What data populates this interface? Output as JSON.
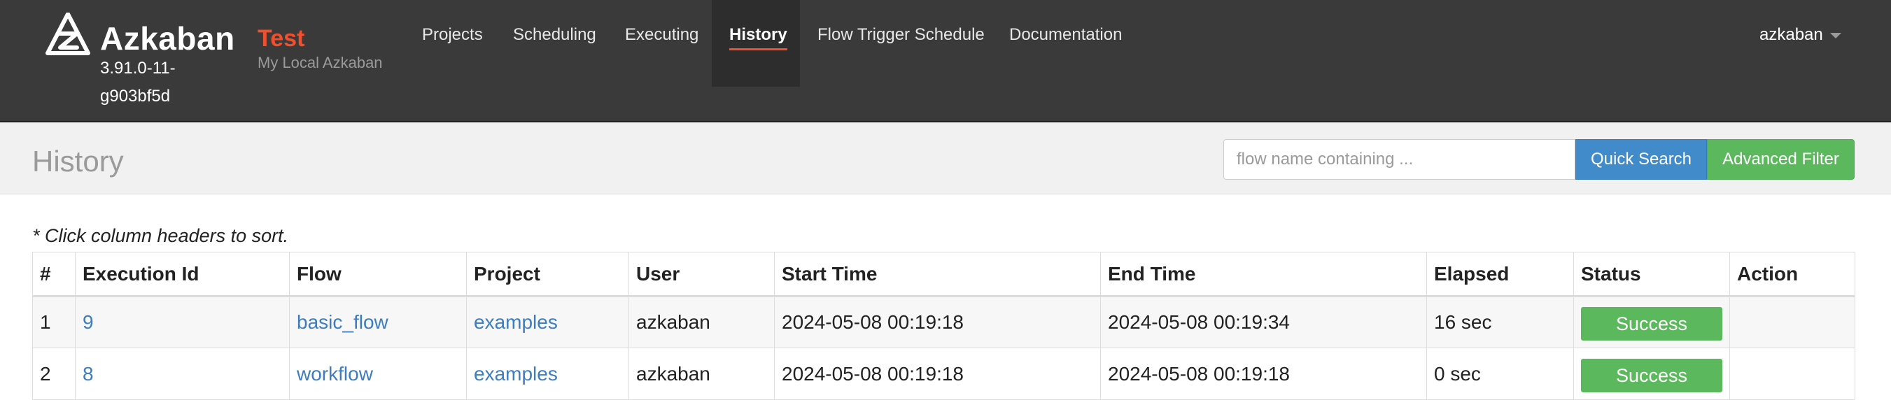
{
  "brand": {
    "name": "Azkaban",
    "version": "3.91.0-11-g903bf5d"
  },
  "environment": {
    "name": "Test",
    "description": "My Local Azkaban"
  },
  "nav": {
    "items": [
      {
        "label": "Projects",
        "active": false
      },
      {
        "label": "Scheduling",
        "active": false
      },
      {
        "label": "Executing",
        "active": false
      },
      {
        "label": "History",
        "active": true
      },
      {
        "label": "Flow Trigger Schedule",
        "active": false
      },
      {
        "label": "Documentation",
        "active": false
      }
    ],
    "user": "azkaban"
  },
  "page": {
    "title": "History"
  },
  "search": {
    "placeholder": "flow name containing ...",
    "value": "",
    "quick_search_label": "Quick Search",
    "advanced_filter_label": "Advanced Filter"
  },
  "table": {
    "sort_hint": "* Click column headers to sort.",
    "headers": [
      "#",
      "Execution Id",
      "Flow",
      "Project",
      "User",
      "Start Time",
      "End Time",
      "Elapsed",
      "Status",
      "Action"
    ],
    "rows": [
      {
        "index": "1",
        "execution_id": "9",
        "flow": "basic_flow",
        "project": "examples",
        "user": "azkaban",
        "start_time": "2024-05-08 00:19:18",
        "end_time": "2024-05-08 00:19:34",
        "elapsed": "16 sec",
        "status": "Success",
        "action": ""
      },
      {
        "index": "2",
        "execution_id": "8",
        "flow": "workflow",
        "project": "examples",
        "user": "azkaban",
        "start_time": "2024-05-08 00:19:18",
        "end_time": "2024-05-08 00:19:18",
        "elapsed": "0 sec",
        "status": "Success",
        "action": ""
      }
    ]
  },
  "colors": {
    "navbar_bg": "#3a3a3a",
    "accent": "#f0502d",
    "link": "#3c7cc0",
    "success": "#5cb85c",
    "primary": "#428bca"
  },
  "icons": {
    "logo": "azkaban-logo-icon",
    "user_dropdown": "caret-down-icon"
  }
}
